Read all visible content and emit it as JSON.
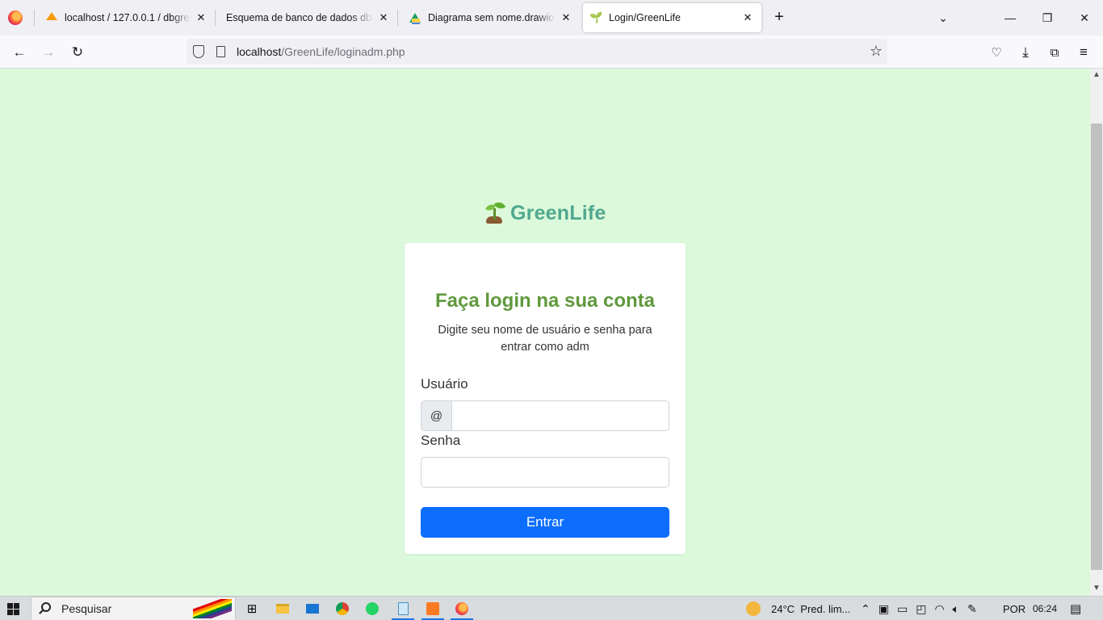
{
  "browser": {
    "tabs": [
      {
        "title": "localhost / 127.0.0.1 / dbgreenli",
        "favicon": "phpmyadmin-icon"
      },
      {
        "title": "Esquema de banco de dados dbgree",
        "favicon": "none"
      },
      {
        "title": "Diagrama sem nome.drawio - G",
        "favicon": "google-drive-icon"
      },
      {
        "title": "Login/GreenLife",
        "favicon": "seedling-icon"
      }
    ],
    "active_tab_index": 3,
    "url_host": "localhost",
    "url_path": "/GreenLife/loginadm.php"
  },
  "page": {
    "brand": "GreenLife",
    "heading": "Faça login na sua conta",
    "subtitle": "Digite seu nome de usuário e senha para entrar como adm",
    "username_label": "Usuário",
    "username_prefix": "@",
    "username_value": "",
    "password_label": "Senha",
    "password_value": "",
    "submit_label": "Entrar",
    "colors": {
      "background": "#dcfadb",
      "brand": "#4fa88f",
      "heading": "#60993d",
      "button": "#0d6efd"
    }
  },
  "taskbar": {
    "search_placeholder": "Pesquisar",
    "weather": "24°C  Pred. lim...",
    "language": "POR",
    "time": "06:24"
  }
}
